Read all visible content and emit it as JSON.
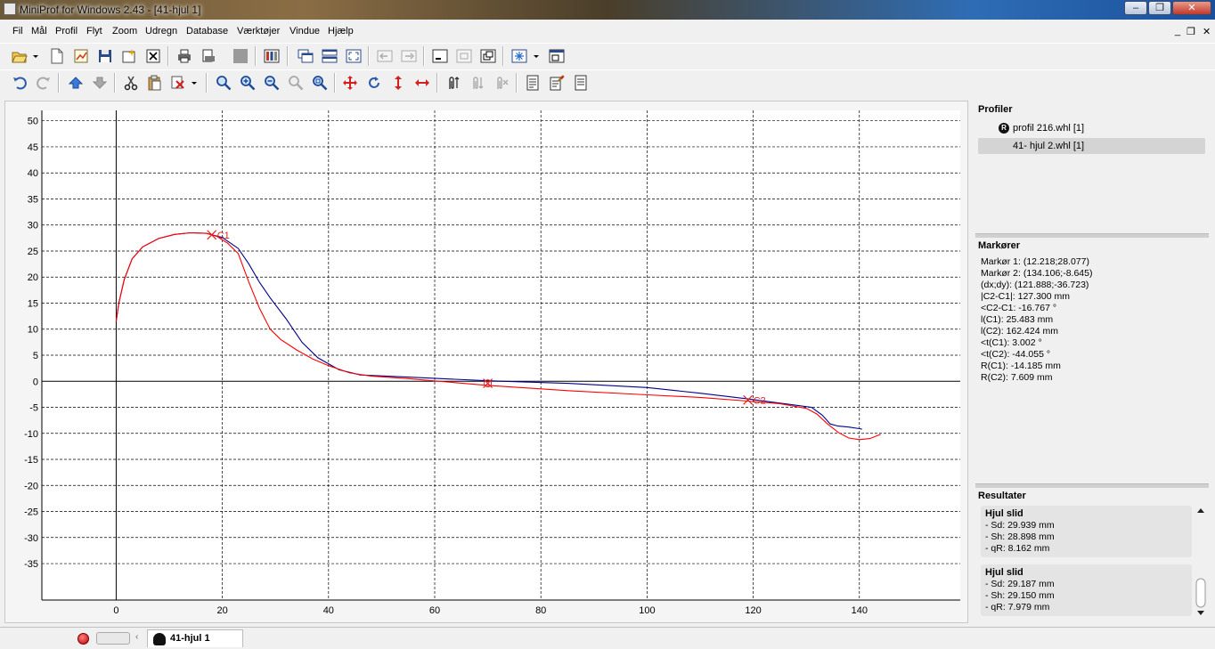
{
  "window": {
    "title": "MiniProf for Windows 2.43 - [41-hjul 1]",
    "minimize": "–",
    "maximize": "❐",
    "close": "✕"
  },
  "menu": {
    "items": [
      "Fil",
      "Mål",
      "Profil",
      "Flyt",
      "Zoom",
      "Udregn",
      "Database",
      "Værktøjer",
      "Vindue",
      "Hjælp"
    ],
    "mdi_min": "_",
    "mdi_restore": "❐",
    "mdi_close": "✕"
  },
  "chart_data": {
    "type": "line",
    "xlim": [
      -14,
      159
    ],
    "ylim": [
      -42,
      52
    ],
    "x_ticks": [
      0,
      20,
      40,
      60,
      80,
      100,
      120,
      140
    ],
    "y_ticks": [
      50,
      45,
      40,
      35,
      30,
      25,
      20,
      15,
      10,
      5,
      0,
      -5,
      -10,
      -15,
      -20,
      -25,
      -30,
      -35
    ],
    "grid": true,
    "series": [
      {
        "color": "#00008b",
        "points": [
          [
            0,
            11.5
          ],
          [
            0.5,
            15
          ],
          [
            1.5,
            19.5
          ],
          [
            3,
            23.5
          ],
          [
            5,
            25.8
          ],
          [
            8,
            27.4
          ],
          [
            11,
            28.2
          ],
          [
            14,
            28.5
          ],
          [
            17,
            28.4
          ],
          [
            20,
            27.6
          ],
          [
            23,
            25.5
          ],
          [
            25,
            22.5
          ],
          [
            27,
            19
          ],
          [
            29,
            16
          ],
          [
            32,
            12
          ],
          [
            35,
            7.5
          ],
          [
            38,
            4.5
          ],
          [
            42,
            2.2
          ],
          [
            46,
            1.2
          ],
          [
            55,
            0.8
          ],
          [
            70,
            0.1
          ],
          [
            85,
            -0.4
          ],
          [
            100,
            -1.2
          ],
          [
            110,
            -2.3
          ],
          [
            119,
            -3.4
          ],
          [
            125,
            -4.2
          ],
          [
            131,
            -5
          ],
          [
            133,
            -6.5
          ],
          [
            134.5,
            -8.2
          ],
          [
            136,
            -8.6
          ],
          [
            138,
            -8.8
          ],
          [
            140,
            -9.1
          ],
          [
            140.5,
            -9.2
          ]
        ]
      },
      {
        "color": "#ff0000",
        "points": [
          [
            0,
            11.5
          ],
          [
            0.5,
            15
          ],
          [
            1.5,
            19.5
          ],
          [
            3,
            23.5
          ],
          [
            5,
            25.8
          ],
          [
            8,
            27.4
          ],
          [
            11,
            28.2
          ],
          [
            14,
            28.5
          ],
          [
            17,
            28.4
          ],
          [
            19,
            27.8
          ],
          [
            21,
            26.5
          ],
          [
            23,
            24.5
          ],
          [
            25,
            19
          ],
          [
            27,
            14
          ],
          [
            29,
            10
          ],
          [
            31,
            8
          ],
          [
            34,
            6
          ],
          [
            37,
            4.3
          ],
          [
            40,
            3
          ],
          [
            44,
            1.6
          ],
          [
            48,
            1
          ],
          [
            55,
            0.5
          ],
          [
            70,
            -0.8
          ],
          [
            85,
            -1.8
          ],
          [
            100,
            -2.6
          ],
          [
            110,
            -3.1
          ],
          [
            119,
            -3.8
          ],
          [
            125,
            -4.3
          ],
          [
            130,
            -5.2
          ],
          [
            132,
            -6.3
          ],
          [
            134,
            -8.2
          ],
          [
            136,
            -9.8
          ],
          [
            138,
            -10.9
          ],
          [
            140,
            -11.2
          ],
          [
            142,
            -11
          ],
          [
            144,
            -10.2
          ]
        ]
      }
    ],
    "cursors": [
      {
        "label": "C1",
        "x": 18,
        "y": 28.1
      },
      {
        "label": "C2",
        "x": 119,
        "y": -3.6
      },
      {
        "label": "",
        "x": 70,
        "y": -0.4
      }
    ]
  },
  "side": {
    "profiles_title": "Profiler",
    "ref_badge": "R",
    "profiles": [
      "profil 216.whl [1]",
      "41- hjul 2.whl [1]"
    ],
    "markers_title": "Markører",
    "markers": [
      "Markør 1: (12.218;28.077)",
      "Markør 2: (134.106;-8.645)",
      "(dx;dy): (121.888;-36.723)",
      "|C2-C1|: 127.300 mm",
      "<C2-C1: -16.767 °",
      "l(C1): 25.483 mm",
      "l(C2): 162.424 mm",
      "<t(C1): 3.002 °",
      "<t(C2): -44.055 °",
      "R(C1): -14.185 mm",
      "R(C2): 7.609 mm"
    ],
    "results_title": "Resultater",
    "results": [
      {
        "title": "Hjul slid",
        "lines": [
          "- Sd: 29.939 mm",
          "- Sh: 28.898 mm",
          "- qR: 8.162 mm"
        ]
      },
      {
        "title": "Hjul slid",
        "lines": [
          "- Sd: 29.187 mm",
          "- Sh: 29.150 mm",
          "- qR: 7.979 mm"
        ]
      }
    ]
  },
  "status": {
    "tab_label": "41-hjul 1"
  }
}
